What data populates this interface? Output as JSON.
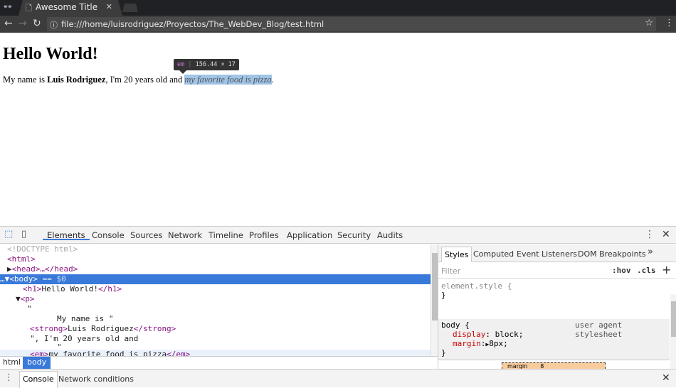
{
  "browser": {
    "tab_title": "Awesome Title",
    "url": "file:///home/luisrodriguez/Proyectos/The_WebDev_Blog/test.html"
  },
  "page": {
    "heading": "Hello World!",
    "p_before": "My name is ",
    "strong": "Luis Rodriguez",
    "p_middle": ", I'm 20 years old and ",
    "em": "my favorite food is pizza",
    "p_end": ".",
    "tooltip": {
      "tag": "em",
      "size": "156.44 × 17"
    }
  },
  "devtools": {
    "tabs": [
      "Elements",
      "Console",
      "Sources",
      "Network",
      "Timeline",
      "Profiles",
      "Application",
      "Security",
      "Audits"
    ],
    "active_tab": "Elements",
    "dom": {
      "doctype": "<!DOCTYPE html>",
      "html_open": "<html>",
      "head": "<head>…</head>",
      "body": "<body>",
      "body_ref": " == $0",
      "h1_open": "<h1>",
      "h1_text": "Hello World!",
      "h1_close": "</h1>",
      "p_open": "<p>",
      "quote": "\"",
      "name_text": "My name is \"",
      "strong_open": "<strong>",
      "strong_text": "Luis Rodriguez",
      "strong_close": "</strong>",
      "age_text": "\", I'm 20 years old and",
      "em_open": "<em>",
      "em_text": "my favorite food is pizza",
      "em_close": "</em>"
    },
    "breadcrumbs": [
      "html",
      "body"
    ],
    "side_tabs": [
      "Styles",
      "Computed",
      "Event Listeners",
      "DOM Breakpoints"
    ],
    "more": "»",
    "filter_placeholder": "Filter",
    "hov": ":hov",
    "cls": ".cls",
    "add": "+",
    "element_style": "element.style {",
    "close_brace": "}",
    "rule": {
      "selector": "body {",
      "source": "user agent stylesheet",
      "props": [
        {
          "name": "display",
          "value": "block;"
        },
        {
          "name": "margin",
          "value": "8px;"
        }
      ]
    },
    "boxmodel": {
      "label": "margin",
      "value": "8"
    },
    "drawer_tabs": [
      "Console",
      "Network conditions"
    ]
  }
}
